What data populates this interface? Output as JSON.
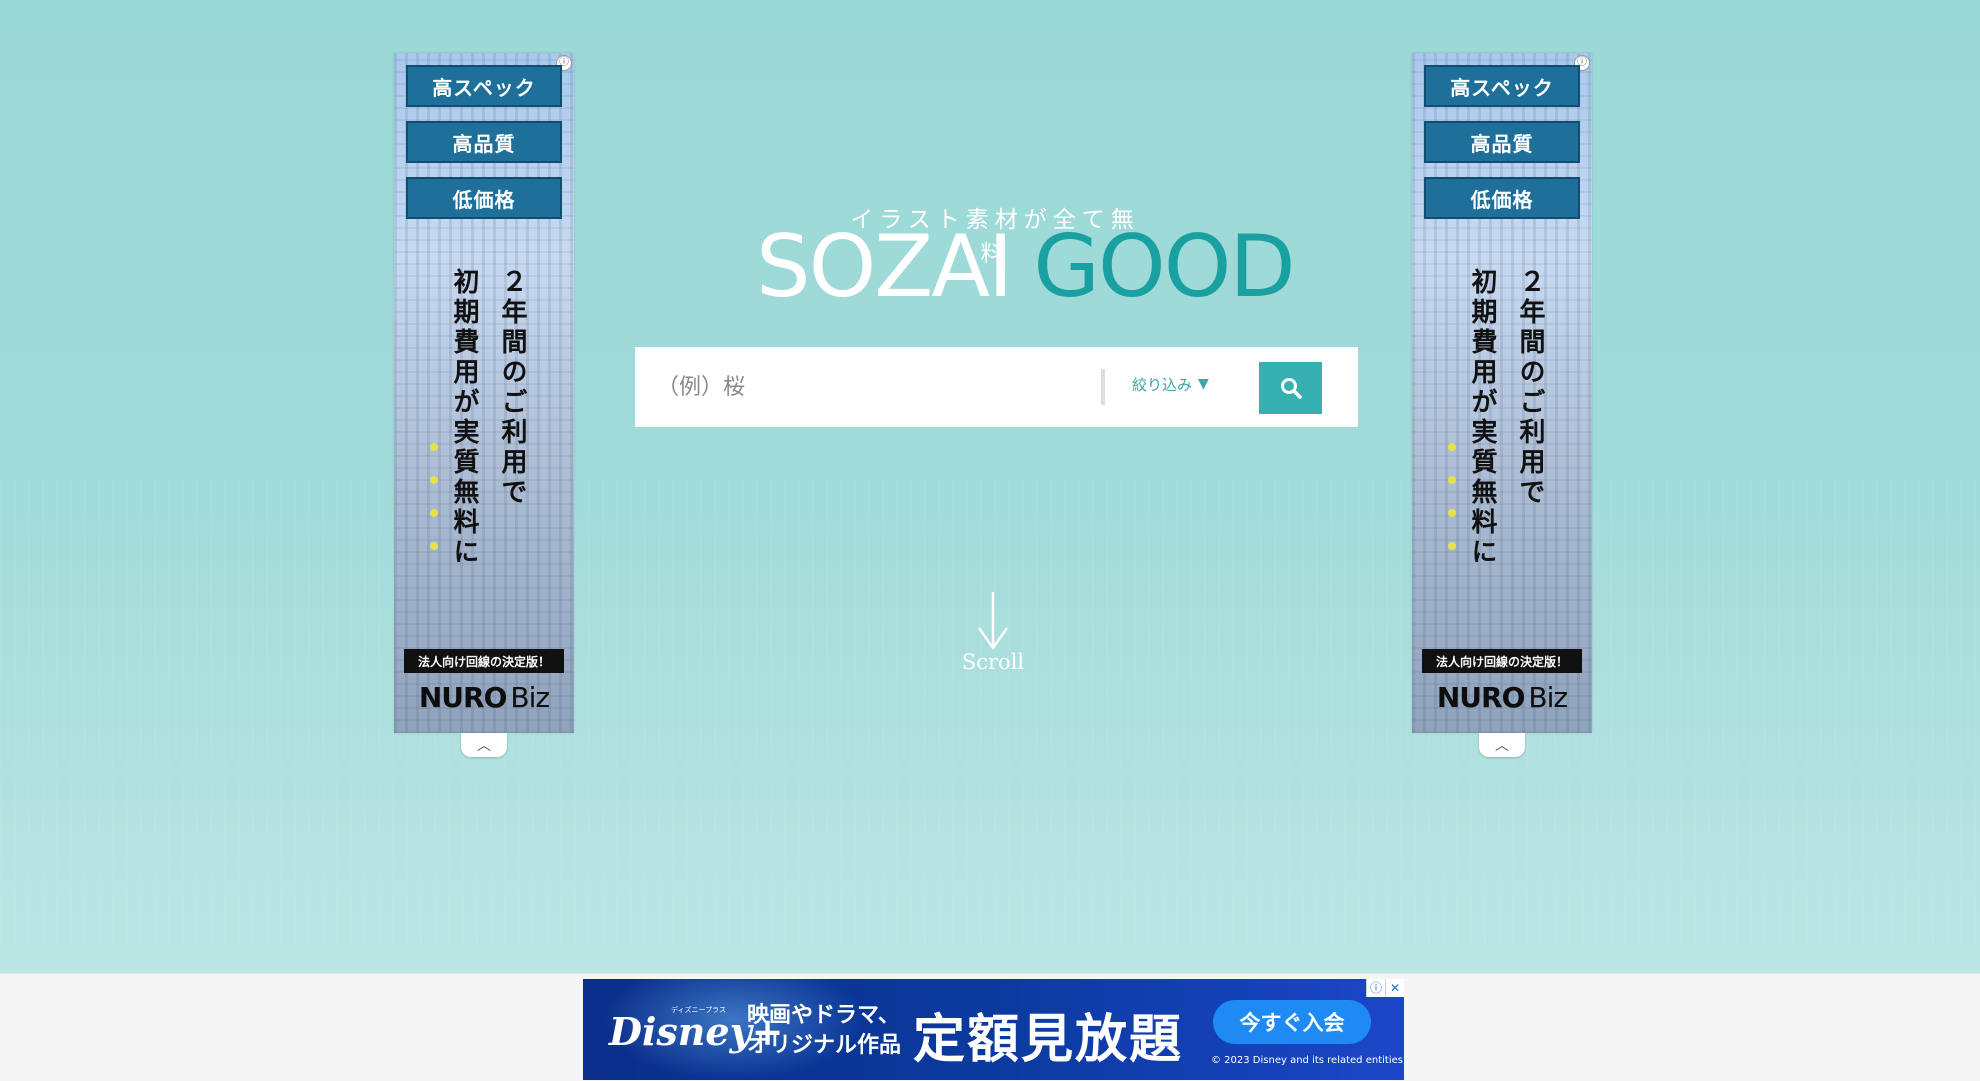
{
  "side_ads": {
    "buttons": [
      "高スペック",
      "高品質",
      "低価格"
    ],
    "vertical_lines": [
      "２年間のご利用で",
      "初期費用が実質無料に"
    ],
    "tag": "法人向け回線の決定版！",
    "brand": "NURO",
    "brand_suffix": "Biz",
    "info_icon": "ⓘ",
    "collapse_icon": "︿"
  },
  "hero": {
    "tagline": "イラスト素材が全て無料",
    "logo_white": "SOZAI",
    "logo_green": "GOOD",
    "logo_green_color": "#1aa0a0"
  },
  "search": {
    "placeholder": "（例）桜",
    "value": "",
    "filter_label": "絞り込み",
    "filter_caret": "▼",
    "button_icon": "search-icon",
    "button_color": "#36b0b0"
  },
  "scroll": {
    "label": "Scroll"
  },
  "bottom_ad": {
    "logo": "Disney+",
    "logo_small": "ディズニープラス",
    "copy_line1": "映画やドラマ、",
    "copy_line2": "オリジナル作品",
    "headline": "定額見放題",
    "cta": "今すぐ入会",
    "copyright": "© 2023 Disney and its related entities",
    "info_icon": "ⓘ",
    "close_icon": "✕"
  }
}
